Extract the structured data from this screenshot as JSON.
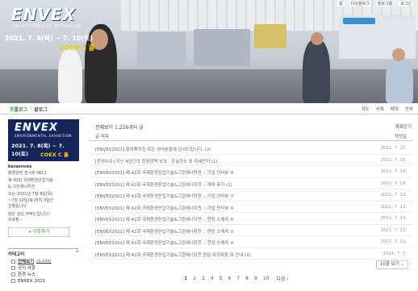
{
  "banner": {
    "logo": "ENVEX",
    "logo_sub": "ENVIRONMENTAL EXHIBITION",
    "dates": "2021. 7. 8(목) ~ 7. 10(토)",
    "venue": "COEX C 홀",
    "top_links": [
      "홈",
      "이웃블로그",
      "블로그홈",
      "로그인"
    ]
  },
  "nav": {
    "prologue": "프롤로그",
    "separator": "|",
    "blog": "블로그",
    "right_links": [
      "지도",
      "서재",
      "메모",
      "안부"
    ]
  },
  "sidebar": {
    "banner_logo": "ENVEX",
    "banner_sub": "ENVIRONMENTAL EXHIBITION",
    "banner_dates": "2021. 7. 8(목) ~ 7. 10(토)",
    "banner_venue": "COEX C 홀",
    "nickname": "keraenvex",
    "profile_lines": [
      "환경관련 전시회 NO.1",
      "제 42회 국제환경산업기술",
      "& 그린에너지전",
      "오는 2021년 7월 8일(목)",
      "~7월 10일(토)까지 3일간",
      "진행됩니다.",
      "많은 관심 부탁드립니다!",
      "프로필 ›"
    ],
    "neighbor_button": "+ 이웃추가",
    "category": {
      "title": "카테고리",
      "toggle": "^",
      "items": [
        {
          "label": "전체보기",
          "count": "(1,226)",
          "active": true
        },
        {
          "label": "공지 사항",
          "count": "",
          "active": false
        },
        {
          "label": "환경 뉴스",
          "count": "",
          "active": false
        },
        {
          "label": "ENVEX 2021",
          "count": "",
          "active": false
        }
      ]
    }
  },
  "main": {
    "list_title": "전체보기",
    "list_count": "1,226개의 글",
    "list_toggle": "목록닫기",
    "col_title": "글 제목",
    "col_date": "작성일",
    "rows": [
      {
        "title": "[ENVEX2021] 참여해주신 모든 여러분들께 감사드립니다.",
        "comments": "(2)",
        "date": "2021. 7. 15."
      },
      {
        "title": "[환경이슈] 지난 4년간의 환경정책 성과 : 온실가스 및 미세먼지",
        "comments": "(1)",
        "date": "2021. 7. 15."
      },
      {
        "title": "[ENVEX2021] 제 42회 국제환경산업기술&그린에너지전 :: 기업 인터뷰 ⑧",
        "comments": "",
        "date": "2021. 7. 14."
      },
      {
        "title": "[ENVEX2021] 제 42회 국제환경산업기술&그린에너지전 :: 개막 후기",
        "comments": "(1)",
        "date": "2021. 7. 14."
      },
      {
        "title": "[ENVEX2021] 제 42회 국제환경산업기술&그린에너지전 :: 기업 인터뷰 ⑦",
        "comments": "",
        "date": "2021. 7. 13."
      },
      {
        "title": "[ENVEX2021] 제 42회 국제환경산업기술&그린에너지전 :: 기업 인터뷰 ⑥",
        "comments": "",
        "date": "2021. 7. 13."
      },
      {
        "title": "[ENVEX2021] 제 42회 국제환경산업기술&그린에너지전 :: 현장 스케치 ⑥",
        "comments": "",
        "date": "2021. 7. 13."
      },
      {
        "title": "[ENVEX2021] 제 42회 국제환경산업기술&그린에너지전 :: 현장 스케치 ⑤",
        "comments": "",
        "date": "2021. 7. 13."
      },
      {
        "title": "[ENVEX2021] 제 42회 국제환경산업기술&그린에너지전 :: 현장 스케치 ④",
        "comments": "",
        "date": "2021. 7. 12."
      },
      {
        "title": "[ENVEX2021] 제 42회 국제환경산업기술&그린에너지전 방문 유의사항 및 안내",
        "comments": "(2)",
        "date": "2021. 7. 7."
      }
    ],
    "per_page": "10줄 보기 ⌄",
    "pages": [
      "1",
      "2",
      "3",
      "4",
      "5",
      "6",
      "7",
      "8",
      "9",
      "10"
    ],
    "next_label": "다음 ›"
  }
}
